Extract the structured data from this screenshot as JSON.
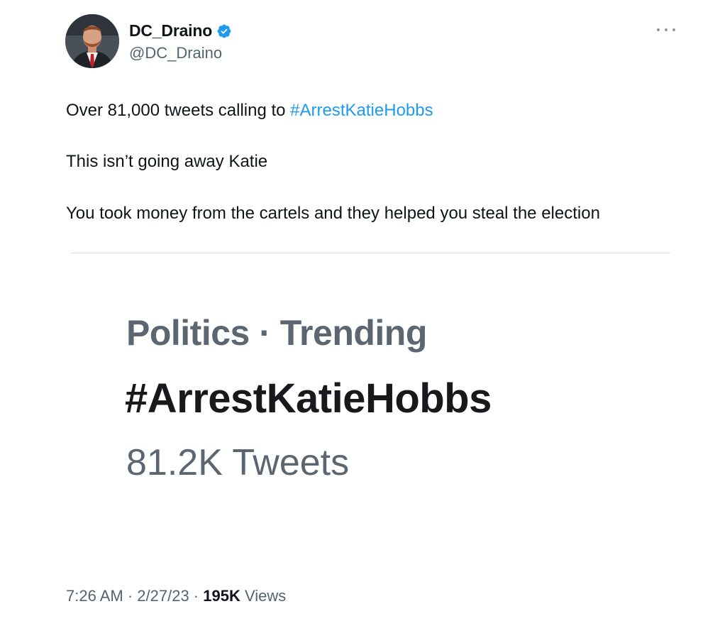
{
  "author": {
    "display_name": "DC_Draino",
    "handle": "@DC_Draino",
    "verified": true
  },
  "tweet": {
    "line1_prefix": "Over 81,000 tweets calling to ",
    "line1_hashtag": "#ArrestKatieHobbs",
    "line2": "This isn’t going away Katie",
    "line3": "You took money from the cartels and they helped you steal the election"
  },
  "media": {
    "trend_context": "Politics · Trending",
    "trend_name": "#ArrestKatieHobbs",
    "trend_count": "81.2K Tweets"
  },
  "footer": {
    "time": "7:26 AM",
    "separator": " · ",
    "date": "2/27/23",
    "views_count": "195K",
    "views_label": " Views"
  },
  "colors": {
    "link": "#1d9bf0",
    "verified_badge": "#1d9bf0",
    "secondary_text": "#536471"
  },
  "icons": {
    "verified": "verified-badge-icon",
    "more": "more-options-icon"
  }
}
